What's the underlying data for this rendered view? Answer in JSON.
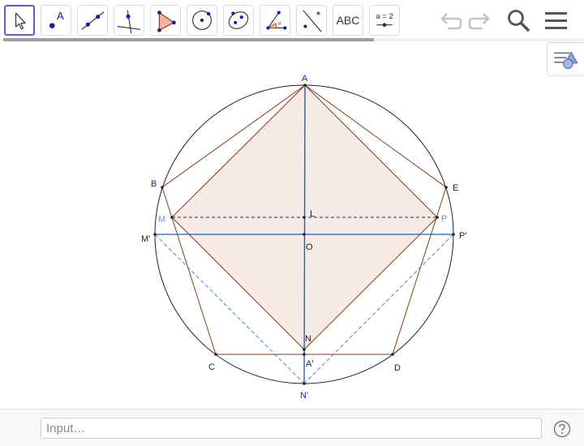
{
  "toolbar": {
    "tools": [
      {
        "name": "move",
        "icon": "arrow-cursor-icon",
        "selected": true
      },
      {
        "name": "point",
        "icon": "point-icon",
        "label": "A"
      },
      {
        "name": "line",
        "icon": "line-through-points-icon"
      },
      {
        "name": "perpendicular",
        "icon": "perpendicular-line-icon"
      },
      {
        "name": "polygon",
        "icon": "polygon-icon"
      },
      {
        "name": "circle",
        "icon": "circle-center-point-icon"
      },
      {
        "name": "ellipse",
        "icon": "ellipse-icon"
      },
      {
        "name": "angle",
        "icon": "angle-icon"
      },
      {
        "name": "reflect",
        "icon": "reflect-about-line-icon"
      },
      {
        "name": "text",
        "icon": "text-icon",
        "label": "ABC"
      },
      {
        "name": "slider",
        "icon": "slider-icon",
        "label": "a = 2"
      }
    ],
    "progress": 0.64,
    "undo_icon": "undo-icon",
    "redo_icon": "redo-icon",
    "search_icon": "search-icon",
    "menu_icon": "menu-icon"
  },
  "style_bar_icon": "style-bar-icon",
  "figure": {
    "points": {
      "A": "A",
      "B": "B",
      "C": "C",
      "D": "D",
      "E": "E",
      "M": "M",
      "P": "P",
      "M_prime": "M'",
      "P_prime": "P'",
      "N": "N",
      "N_prime": "N'",
      "O": "O",
      "L": "L",
      "A_prime": "A'"
    }
  },
  "input_bar": {
    "placeholder": "Input…",
    "help_icon": "help-icon"
  },
  "colors": {
    "accent": "#6557d2",
    "point_blue": "#1a1aa6",
    "line_blue": "#1565c0",
    "dash_blue": "#4a7fd4",
    "polygon_brown": "#8b3a0e",
    "fill": "#f3e6e1"
  }
}
